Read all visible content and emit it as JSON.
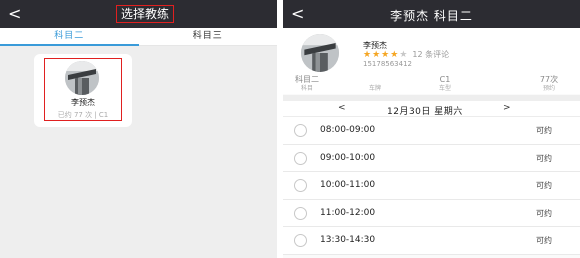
{
  "left": {
    "title": "选择教练",
    "tabs": [
      "科目二",
      "科目三"
    ],
    "coach": {
      "name": "李预杰",
      "info": "已约 77 次 | C1"
    }
  },
  "right": {
    "title": "李预杰 科目二",
    "profile": {
      "name": "李预杰",
      "stars_filled": 4,
      "stars_total": 5,
      "reviews": "12 条评论",
      "phone": "15178563412"
    },
    "stats": [
      {
        "value": "科目二",
        "label": "科目"
      },
      {
        "value": "",
        "label": "车牌"
      },
      {
        "value": "C1",
        "label": "车型"
      },
      {
        "value": "77次",
        "label": "预约"
      }
    ],
    "date": {
      "prev": "<",
      "text": "12月30日 星期六",
      "next": ">"
    },
    "slots": [
      {
        "time": "08:00-09:00",
        "status": "可约"
      },
      {
        "time": "09:00-10:00",
        "status": "可约"
      },
      {
        "time": "10:00-11:00",
        "status": "可约"
      },
      {
        "time": "11:00-12:00",
        "status": "可约"
      },
      {
        "time": "13:30-14:30",
        "status": "可约"
      }
    ]
  },
  "icons": {
    "back": "back-chevron-icon",
    "star": "star-icon",
    "radio": "radio-circle-icon"
  },
  "colors": {
    "topbar": "#2c2c32",
    "accent": "#3a9bd9",
    "star": "#f5a623",
    "highlight": "#e02020"
  }
}
